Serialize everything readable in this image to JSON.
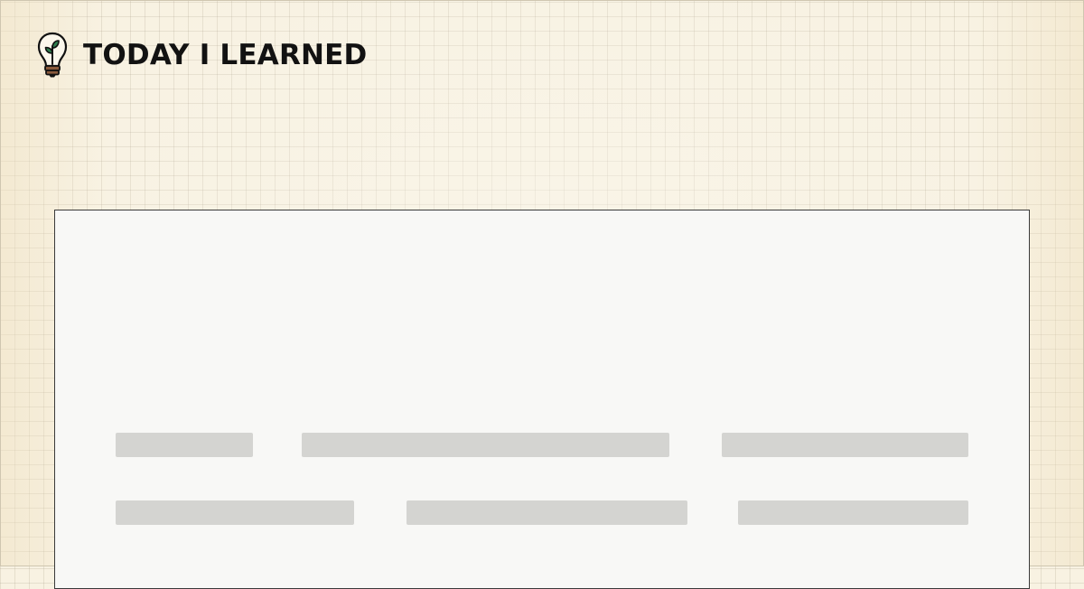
{
  "header": {
    "site_title": "TODAY I LEARNED",
    "logo_icon": "lightbulb-sprout-icon"
  },
  "colors": {
    "background": "#f8f2e2",
    "card_background": "#f8f8f6",
    "card_border": "#3a3a3a",
    "skeleton": "#d4d4d1",
    "title_text": "#121212",
    "logo_leaf": "#2e7d4f",
    "logo_base": "#8a5a3c"
  },
  "card": {
    "state": "loading",
    "skeleton_rows": [
      {
        "placeholders": 3
      },
      {
        "placeholders": 3
      }
    ]
  }
}
